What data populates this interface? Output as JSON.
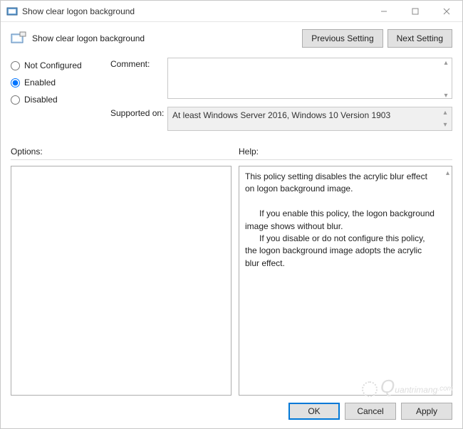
{
  "window": {
    "title": "Show clear logon background"
  },
  "header": {
    "title": "Show clear logon background",
    "prev": "Previous Setting",
    "next": "Next Setting"
  },
  "radios": {
    "not_configured": "Not Configured",
    "enabled": "Enabled",
    "disabled": "Disabled",
    "selected": "enabled"
  },
  "fields": {
    "comment_label": "Comment:",
    "comment_value": "",
    "supported_label": "Supported on:",
    "supported_value": "At least Windows Server 2016, Windows 10 Version 1903"
  },
  "sections": {
    "options": "Options:",
    "help": "Help:"
  },
  "help": {
    "p1": "This policy setting disables the acrylic blur effect on logon background image.",
    "p2": "If you enable this policy, the logon background image shows without blur.",
    "p3": "If you disable or do not configure this policy, the logon background image adopts the acrylic blur effect."
  },
  "footer": {
    "ok": "OK",
    "cancel": "Cancel",
    "apply": "Apply"
  },
  "watermark": "uantrimang"
}
